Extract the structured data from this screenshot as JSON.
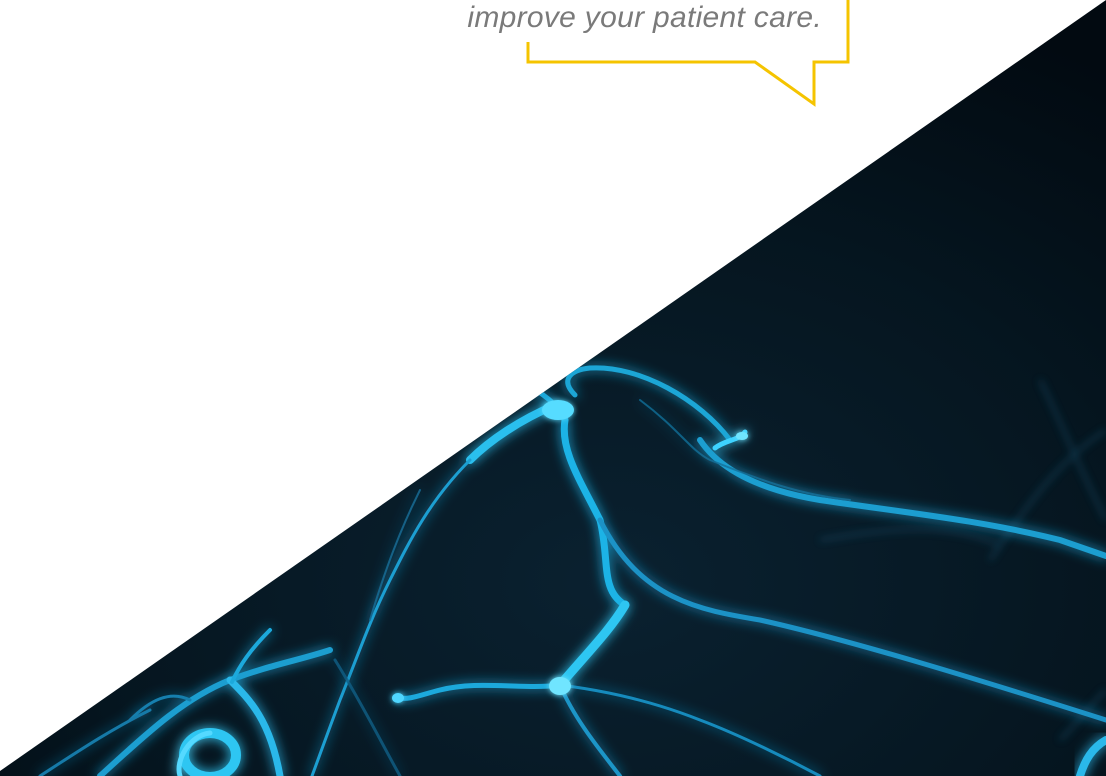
{
  "quote": {
    "text": "improve your patient care."
  },
  "colors": {
    "page_background": "#ffffff",
    "dark_background": "#03131f",
    "neuron_glow": "#2ec6f2",
    "neuron_core": "#8fe9ff",
    "bubble_border": "#f5c400",
    "quote_text": "#7a7a7a"
  },
  "background_image": {
    "icon": "neuron-network-illustration"
  }
}
